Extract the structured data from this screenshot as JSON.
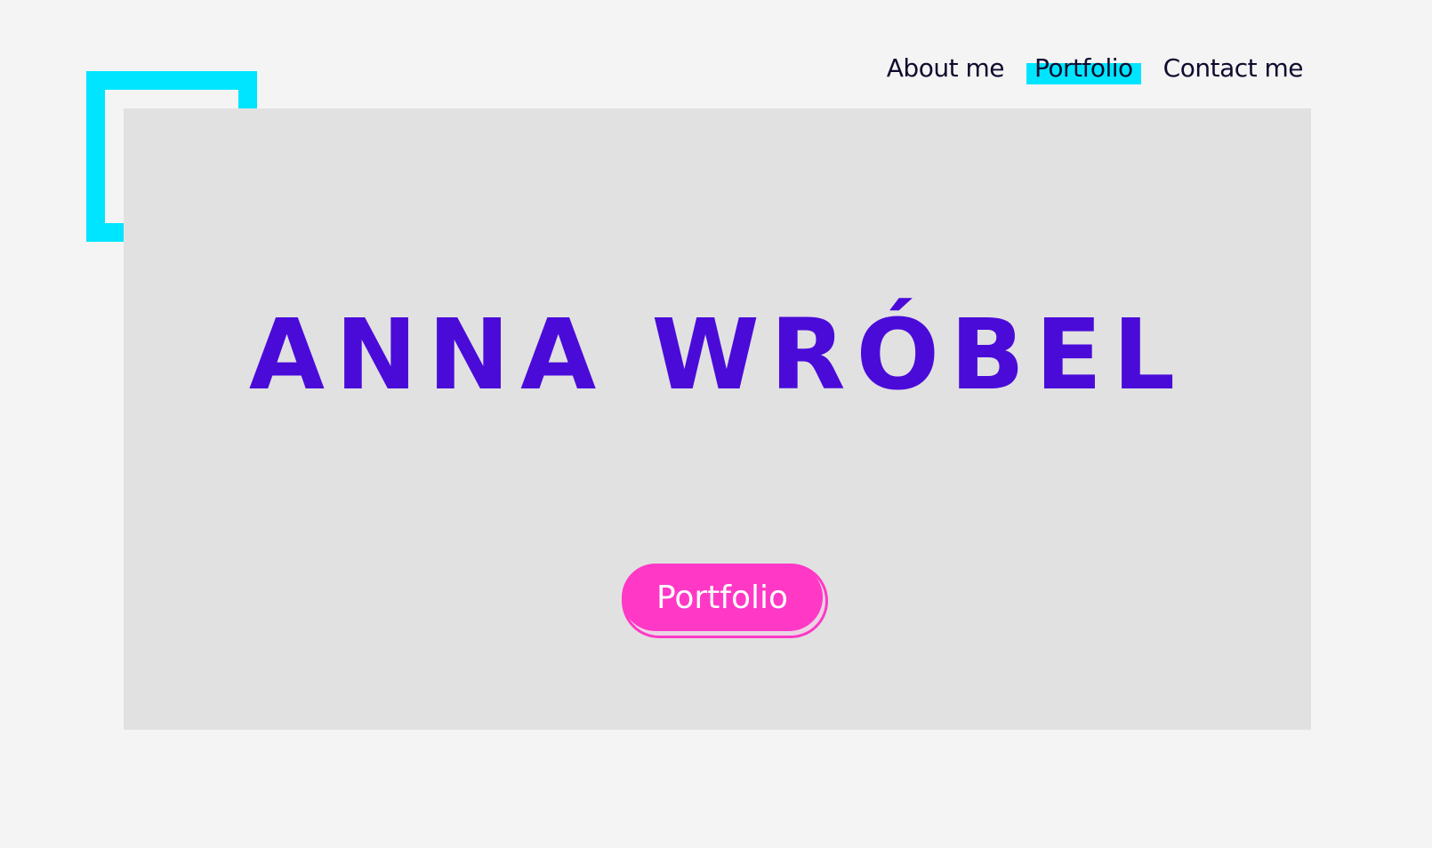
{
  "nav": {
    "items": [
      {
        "label": "About me",
        "active": false
      },
      {
        "label": "Portfolio",
        "active": true
      },
      {
        "label": "Contact me",
        "active": false
      }
    ]
  },
  "hero": {
    "title": "ANNA WRÓBEL",
    "cta_label": "Portfolio"
  },
  "colors": {
    "background": "#f4f4f4",
    "panel": "#e1e1e1",
    "accent_cyan": "#00e5ff",
    "title_purple": "#4a0bd9",
    "cta_pink": "#ff38c6",
    "nav_text": "#0f0b2e"
  }
}
